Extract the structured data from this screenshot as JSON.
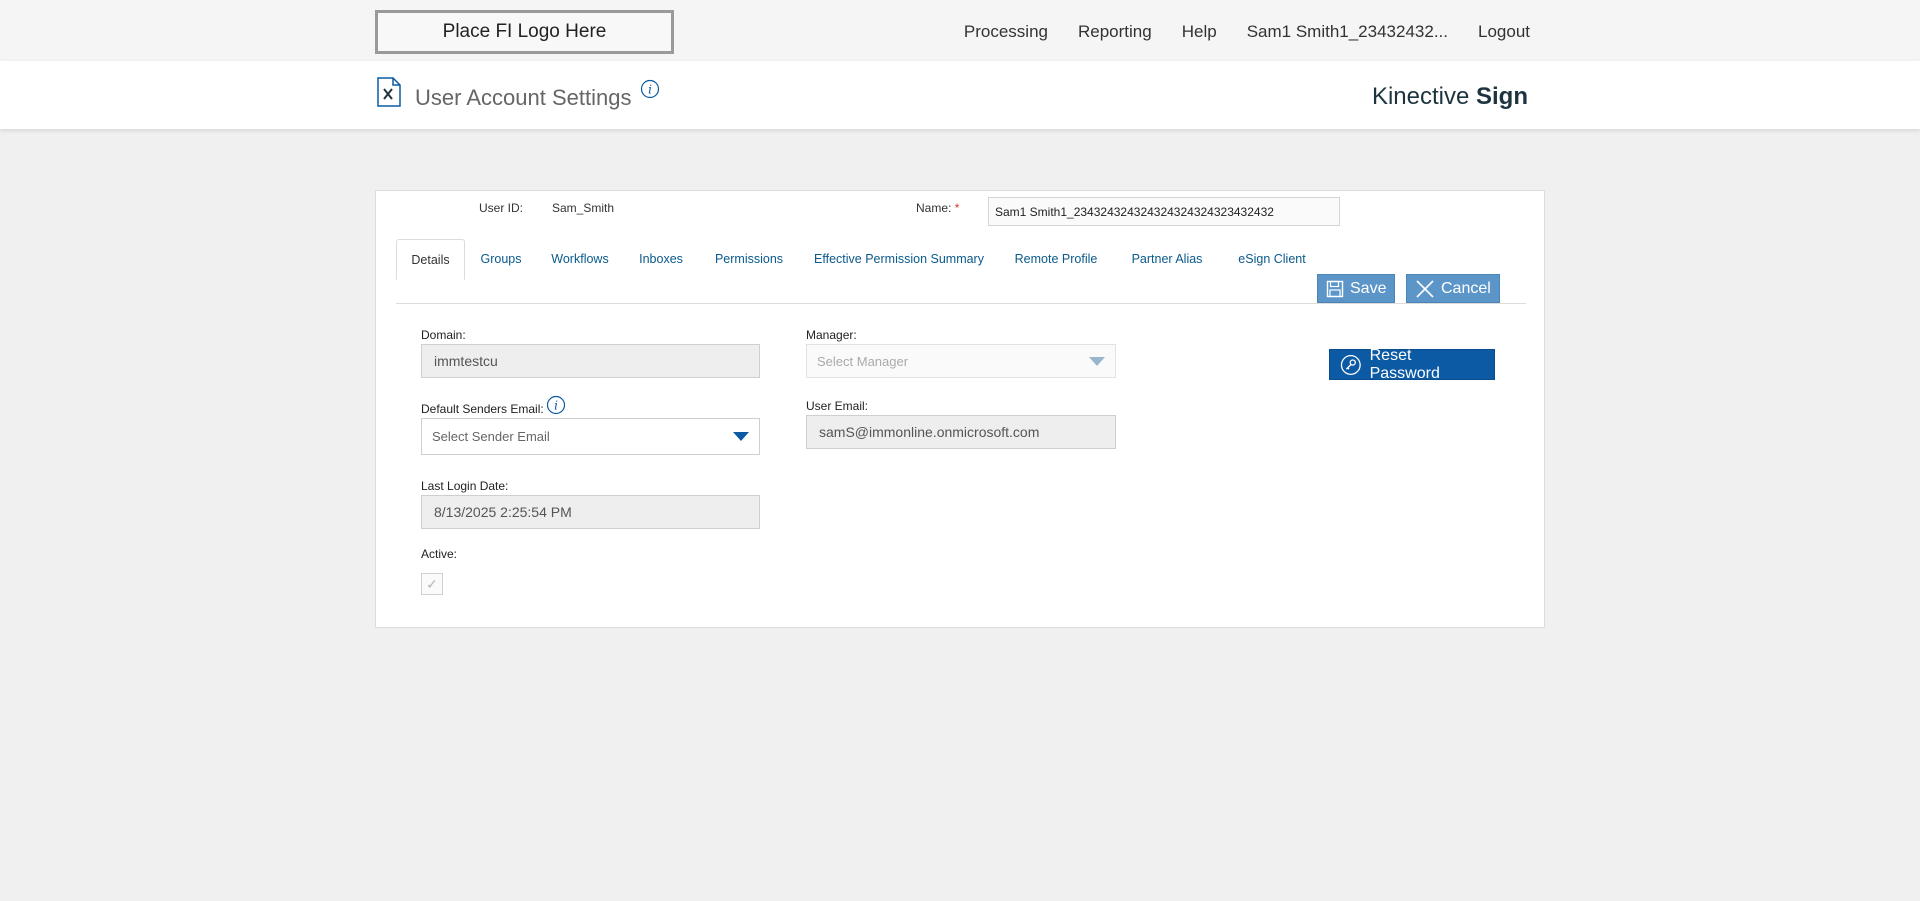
{
  "topbar": {
    "logo_text": "Place FI Logo Here",
    "nav": [
      "Processing",
      "Reporting",
      "Help",
      "Sam1 Smith1_23432432...",
      "Logout"
    ]
  },
  "header": {
    "title": "User Account Settings",
    "brand_light": "Kinective",
    "brand_bold": "Sign"
  },
  "user": {
    "id_label": "User ID:",
    "id_value": "Sam_Smith",
    "name_label": "Name:",
    "name_required": "*",
    "name_value": "Sam1 Smith1_234324324324324324324323432432"
  },
  "tabs": [
    "Details",
    "Groups",
    "Workflows",
    "Inboxes",
    "Permissions",
    "Effective Permission Summary",
    "Remote Profile",
    "Partner Alias",
    "eSign Client"
  ],
  "actions": {
    "save_label": "Save",
    "cancel_label": "Cancel",
    "reset_label": "Reset Password"
  },
  "form": {
    "domain_label": "Domain:",
    "domain_value": "immtestcu",
    "default_email_label": "Default Senders Email:",
    "default_email_placeholder": "Select Sender Email",
    "last_login_label": "Last Login Date:",
    "last_login_value": "8/13/2025 2:25:54 PM",
    "active_label": "Active:",
    "manager_label": "Manager:",
    "manager_placeholder": "Select Manager",
    "user_email_label": "User Email:",
    "user_email_value": "samS@immonline.onmicrosoft.com"
  },
  "colors": {
    "link": "#0a5a8c",
    "primary": "#0b5aa3",
    "button_light": "#5c96c8",
    "required": "#d9342b"
  }
}
